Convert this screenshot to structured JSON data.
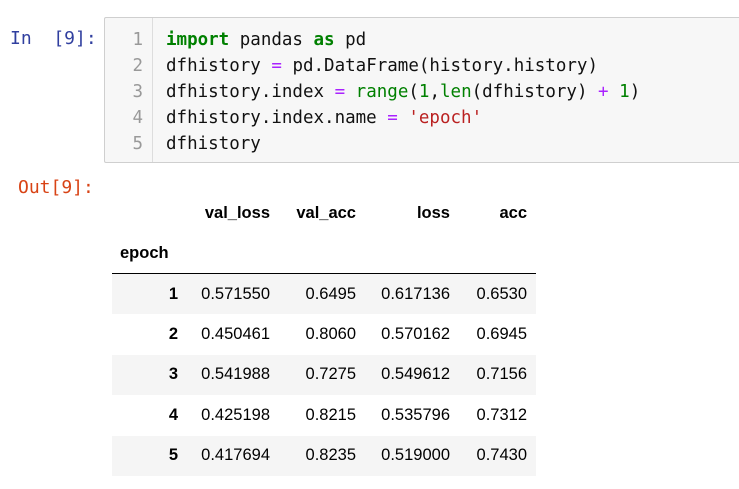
{
  "input_prompt": "In  [9]:",
  "output_prompt": "Out[9]:",
  "code_cell": {
    "line_numbers": [
      "1",
      "2",
      "3",
      "4",
      "5"
    ],
    "lines": {
      "l1": {
        "kw_import": "import",
        "t1": " pandas ",
        "kw_as": "as",
        "t2": " pd"
      },
      "l2": {
        "t1": "dfhistory ",
        "op_eq": "=",
        "t2": " pd.DataFrame(history.history)"
      },
      "l3": {
        "t1": "dfhistory.index ",
        "op_eq": "=",
        "sp": " ",
        "fn_range": "range",
        "t2": "(",
        "n1": "1",
        "t3": ",",
        "fn_len": "len",
        "t4": "(dfhistory) ",
        "op_plus": "+",
        "sp2": " ",
        "n2": "1",
        "t5": ")"
      },
      "l4": {
        "t1": "dfhistory.index.name ",
        "op_eq": "=",
        "sp": " ",
        "str": "'epoch'"
      },
      "l5": {
        "t1": "dfhistory"
      }
    }
  },
  "dataframe": {
    "index_name": "epoch",
    "columns": [
      "val_loss",
      "val_acc",
      "loss",
      "acc"
    ],
    "rows": [
      {
        "index": "1",
        "values": [
          "0.571550",
          "0.6495",
          "0.617136",
          "0.6530"
        ]
      },
      {
        "index": "2",
        "values": [
          "0.450461",
          "0.8060",
          "0.570162",
          "0.6945"
        ]
      },
      {
        "index": "3",
        "values": [
          "0.541988",
          "0.7275",
          "0.549612",
          "0.7156"
        ]
      },
      {
        "index": "4",
        "values": [
          "0.425198",
          "0.8215",
          "0.535796",
          "0.7312"
        ]
      },
      {
        "index": "5",
        "values": [
          "0.417694",
          "0.8235",
          "0.519000",
          "0.7430"
        ]
      }
    ]
  },
  "syntax_colors": {
    "keyword": "#008000",
    "operator": "#aa22ff",
    "string": "#ba2121",
    "number": "#008000",
    "in_prompt": "#303f9f",
    "out_prompt": "#d84315"
  }
}
